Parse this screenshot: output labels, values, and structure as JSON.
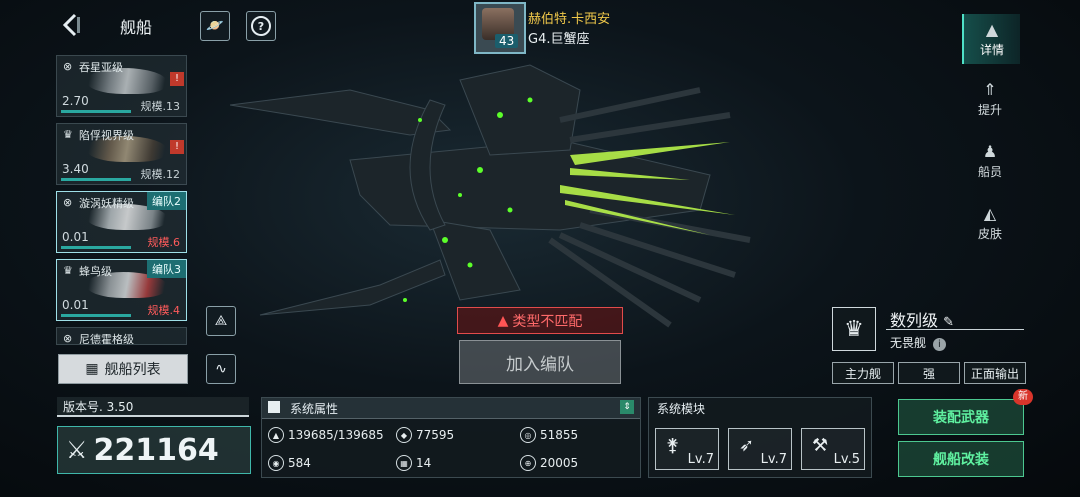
{
  "header": {
    "title": "舰船"
  },
  "commander": {
    "name": "赫伯特.卡西安",
    "level": "43",
    "location": "G4.巨蟹座"
  },
  "ships": [
    {
      "name": "吞星亚级",
      "value": "2.70",
      "scale": "规模.13",
      "warn": "!"
    },
    {
      "name": "陷俘视界级",
      "value": "3.40",
      "scale": "规模.12",
      "warn": "!"
    },
    {
      "name": "漩涡妖精级",
      "value": "0.01",
      "scale": "规模.6",
      "badge": "编队2"
    },
    {
      "name": "蜂鸟级",
      "value": "0.01",
      "scale": "规模.4",
      "badge": "编队3"
    },
    {
      "name": "尼德霍格级"
    }
  ],
  "ship_list_label": "舰船列表",
  "tabs": [
    {
      "label": "详情"
    },
    {
      "label": "提升"
    },
    {
      "label": "船员"
    },
    {
      "label": "皮肤"
    }
  ],
  "center": {
    "mismatch": "类型不匹配",
    "join": "加入编队"
  },
  "class_info": {
    "name": "数列级",
    "subtitle": "无畏舰",
    "tags": [
      "主力舰",
      "强",
      "正面输出"
    ]
  },
  "version": "版本号. 3.50",
  "power": "221164",
  "attributes": {
    "title": "系统属性",
    "values": [
      "139685/139685",
      "77595",
      "51855",
      "584",
      "14",
      "20005"
    ]
  },
  "modules": {
    "title": "系统模块",
    "levels": [
      "Lv.7",
      "Lv.7",
      "Lv.5"
    ]
  },
  "actions": {
    "equip": "装配武器",
    "modify": "舰船改装",
    "new_badge": "新"
  }
}
